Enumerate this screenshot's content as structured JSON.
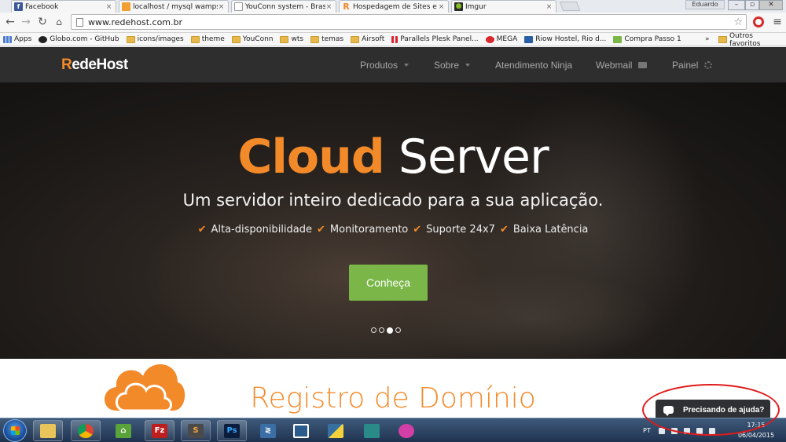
{
  "browser": {
    "tabs": [
      {
        "label": "Facebook",
        "icon": "facebook-icon",
        "color": "#3b5998",
        "glyph": "f"
      },
      {
        "label": "localhost / mysql wampse",
        "icon": "phpmyadmin-icon",
        "color": "#f0a030",
        "glyph": "pma"
      },
      {
        "label": "YouConn system - Brasil",
        "icon": "page-icon",
        "color": "#ffffff",
        "glyph": ""
      },
      {
        "label": "Hospedagem de Sites e C",
        "icon": "redehost-icon",
        "color": "#f38a2a",
        "glyph": "R"
      },
      {
        "label": "Imgur",
        "icon": "imgur-icon",
        "color": "#2b2b2b",
        "glyph": "●"
      }
    ],
    "tab_close": "×",
    "user": "Eduardo",
    "url": "www.redehost.com.br",
    "bookmarks": [
      {
        "label": "Apps",
        "icon": "apps-icon"
      },
      {
        "label": "Globo.com - GitHub",
        "icon": "github-icon"
      },
      {
        "label": "icons/images",
        "icon": "folder-icon"
      },
      {
        "label": "theme",
        "icon": "folder-icon"
      },
      {
        "label": "YouConn",
        "icon": "folder-icon"
      },
      {
        "label": "wts",
        "icon": "folder-icon"
      },
      {
        "label": "temas",
        "icon": "folder-icon"
      },
      {
        "label": "Airsoft",
        "icon": "folder-icon"
      },
      {
        "label": "Parallels Plesk Panel...",
        "icon": "plesk-icon"
      },
      {
        "label": "MEGA",
        "icon": "mega-icon"
      },
      {
        "label": "Riow Hostel, Rio d...",
        "icon": "booking-icon"
      },
      {
        "label": "Compra Passo 1",
        "icon": "shop-icon"
      }
    ],
    "bookmarks_overflow": "»",
    "other_bookmarks": "Outros favoritos"
  },
  "site": {
    "logo_r": "R",
    "logo_rest_a": "ede",
    "logo_rest_b": "Host",
    "nav": [
      {
        "label": "Produtos",
        "suffix": "caret"
      },
      {
        "label": "Sobre",
        "suffix": "caret"
      },
      {
        "label": "Atendimento Ninja",
        "suffix": ""
      },
      {
        "label": "Webmail",
        "suffix": "mail"
      },
      {
        "label": "Painel",
        "suffix": "gear"
      }
    ],
    "hero": {
      "title_accent": "Cloud",
      "title_rest": " Server",
      "subtitle": "Um servidor inteiro dedicado para a sua aplicação.",
      "features": [
        "Alta-disponibilidade",
        "Monitoramento",
        "Suporte 24x7",
        "Baixa Latência"
      ],
      "cta": "Conheça",
      "slides": 4,
      "active_slide": 3
    },
    "section_title": "Registro de Domínio",
    "help_button": "Precisando de ajuda?"
  },
  "taskbar": {
    "lang": "PT",
    "time": "17:15",
    "date": "06/04/2015"
  },
  "colors": {
    "brand_orange": "#f38a2a",
    "cta_green": "#7ab648",
    "nav_bg": "#2e2e2e",
    "annotation_red": "#e01b1b"
  }
}
